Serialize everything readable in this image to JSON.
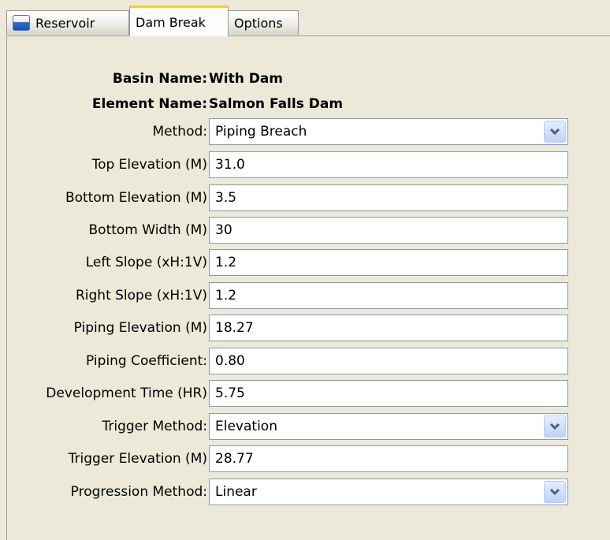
{
  "tabs": [
    {
      "label": "Reservoir",
      "icon": "reservoir-icon"
    },
    {
      "label": "Dam Break",
      "active": true
    },
    {
      "label": "Options"
    }
  ],
  "header": {
    "basin_label": "Basin Name:",
    "basin_value": "With Dam",
    "element_label": "Element Name:",
    "element_value": "Salmon Falls Dam"
  },
  "fields": {
    "method": {
      "label": "Method:",
      "value": "Piping Breach"
    },
    "top_elevation": {
      "label": "Top Elevation (M)",
      "value": "31.0"
    },
    "bottom_elevation": {
      "label": "Bottom Elevation (M)",
      "value": "3.5"
    },
    "bottom_width": {
      "label": "Bottom Width (M)",
      "value": "30"
    },
    "left_slope": {
      "label": "Left Slope (xH:1V)",
      "value": "1.2"
    },
    "right_slope": {
      "label": "Right Slope (xH:1V)",
      "value": "1.2"
    },
    "piping_elevation": {
      "label": "Piping Elevation (M)",
      "value": "18.27"
    },
    "piping_coefficient": {
      "label": "Piping Coefficient:",
      "value": "0.80"
    },
    "development_time": {
      "label": "Development Time (HR)",
      "value": "5.75"
    },
    "trigger_method": {
      "label": "Trigger Method:",
      "value": "Elevation"
    },
    "trigger_elevation": {
      "label": "Trigger Elevation (M)",
      "value": "28.77"
    },
    "progression_method": {
      "label": "Progression Method:",
      "value": "Linear"
    }
  },
  "colors": {
    "panel_bg": "#ece9d8",
    "active_tab_accent": "#ffc83c",
    "field_border": "#7f9db9"
  }
}
